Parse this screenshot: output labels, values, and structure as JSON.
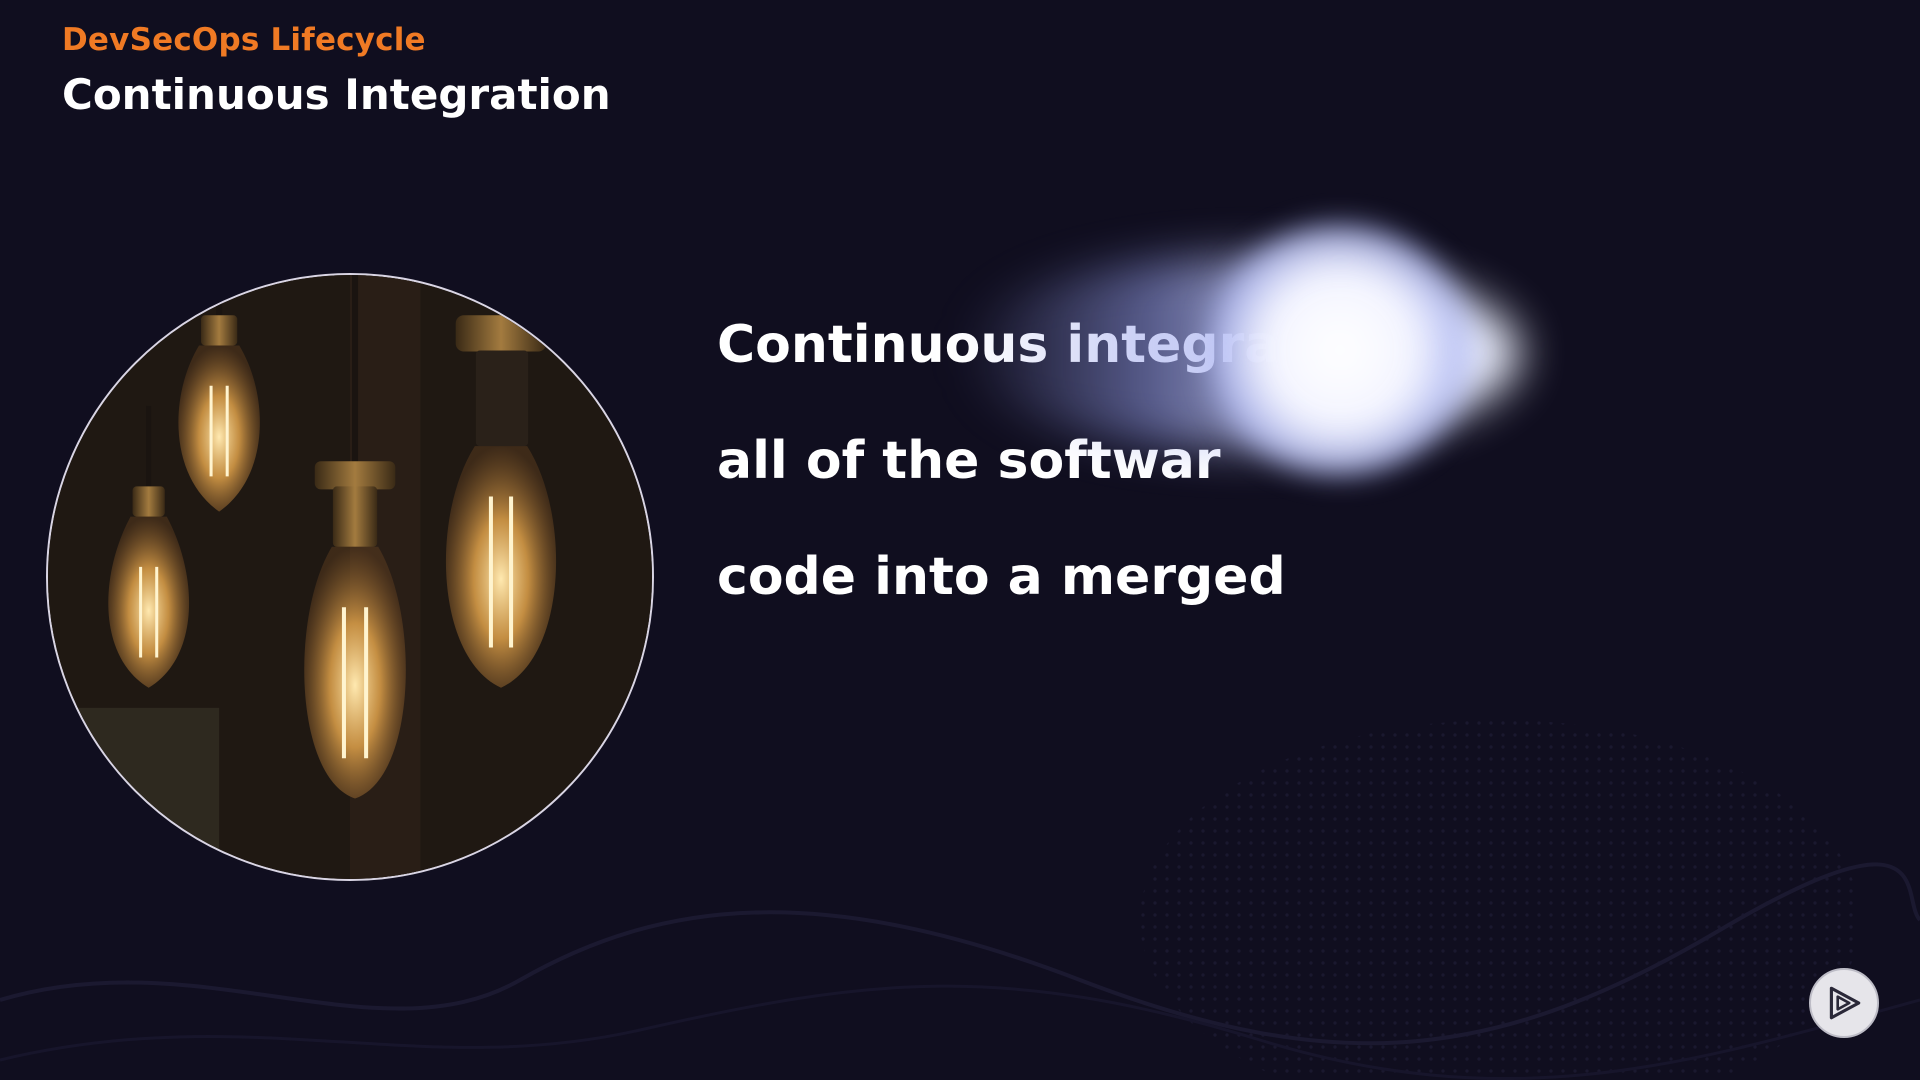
{
  "header": {
    "eyebrow": "DevSecOps Lifecycle",
    "title": "Continuous Integration"
  },
  "content": {
    "text_lines": [
      "Continuous integra",
      "all of the softwar",
      "code into a merged"
    ]
  },
  "controls": {
    "play_icon": "play-icon"
  },
  "colors": {
    "background": "#100e1f",
    "accent": "#f07a24",
    "text": "#ffffff",
    "glow": "#f4f5ff"
  }
}
